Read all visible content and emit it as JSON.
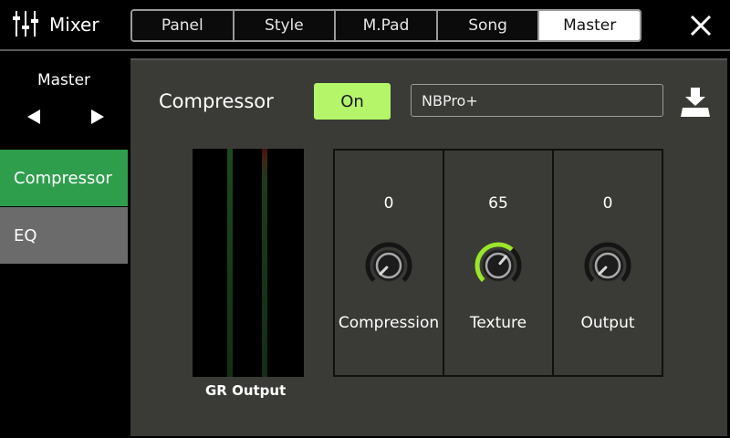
{
  "app": {
    "title": "Mixer",
    "icon": "mixer-sliders-icon"
  },
  "tabs": [
    {
      "label": "Panel",
      "active": false
    },
    {
      "label": "Style",
      "active": false
    },
    {
      "label": "M.Pad",
      "active": false
    },
    {
      "label": "Song",
      "active": false
    },
    {
      "label": "Master",
      "active": true
    }
  ],
  "close_icon": "close-icon",
  "sidebar": {
    "section": "Master",
    "prev_icon": "triangle-left-icon",
    "next_icon": "triangle-right-icon",
    "items": [
      {
        "label": "Compressor",
        "selected": true
      },
      {
        "label": "EQ",
        "selected": false
      }
    ]
  },
  "compressor": {
    "title": "Compressor",
    "on_label": "On",
    "type": "NBPro+",
    "save_icon": "save-download-icon",
    "meter_label": "GR Output",
    "knobs": [
      {
        "name": "Compression",
        "value": "0",
        "level": 0
      },
      {
        "name": "Texture",
        "value": "65",
        "level": 0.65
      },
      {
        "name": "Output",
        "value": "0",
        "level": 0
      }
    ]
  },
  "colors": {
    "on_green": "#b4f56a",
    "selected_green": "#2e9e4d",
    "panel_bg": "#3a3b37",
    "knob_arc": "#9be52a"
  }
}
